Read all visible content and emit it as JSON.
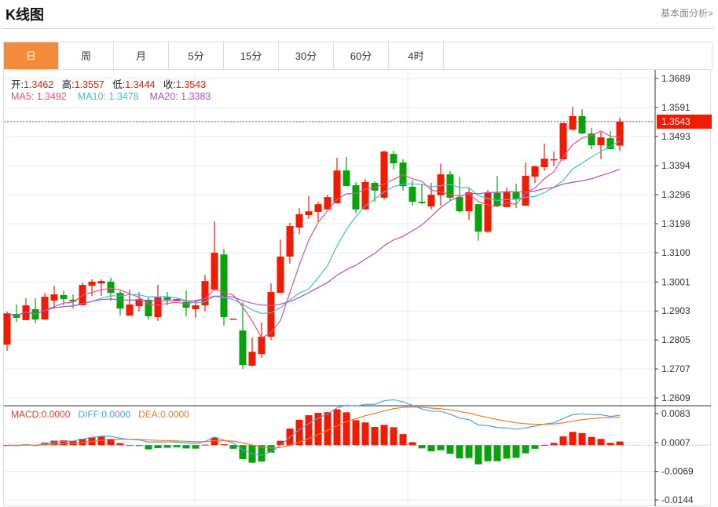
{
  "header": {
    "title": "K线图",
    "fundamental_link": "基本面分析>"
  },
  "tabs": [
    "日",
    "周",
    "月",
    "5分",
    "15分",
    "30分",
    "60分",
    "4时"
  ],
  "active_tab": 0,
  "ohlc_info": {
    "open_label": "开:",
    "open": "1.3462",
    "high_label": "高:",
    "high": "1.3557",
    "low_label": "低:",
    "low": "1.3444",
    "close_label": "收:",
    "close": "1.3543"
  },
  "ma_info": {
    "ma5_label": "MA5: ",
    "ma5": "1.3492",
    "ma10_label": "MA10: ",
    "ma10": "1.3478",
    "ma20_label": "MA20: ",
    "ma20": "1.3383"
  },
  "macd_info": {
    "macd": "MACD:0.0000",
    "diff": "DIFF:0.0000",
    "dea": "DEA:0.0000"
  },
  "current_price": "1.3543",
  "colors": {
    "up": "#f21a00",
    "down": "#0aa20a",
    "ma5": "#e8508a",
    "ma10": "#3fbfd8",
    "ma20": "#b150c8",
    "diff": "#4aa3e8",
    "dea": "#f57a20",
    "active_tab": "#f28c3c"
  },
  "chart_data": {
    "type": "candlestick",
    "price_ticks": [
      "1.3689",
      "1.3591",
      "1.3493",
      "1.3394",
      "1.3296",
      "1.3198",
      "1.3100",
      "1.3001",
      "1.2903",
      "1.2805",
      "1.2707",
      "1.2609"
    ],
    "price_range": [
      1.2609,
      1.3689
    ],
    "macd_ticks": [
      "0.0083",
      "0.0007",
      "-0.0069",
      "-0.0144"
    ],
    "macd_range": [
      -0.0144,
      0.0083
    ],
    "ohlc": [
      [
        1.2789,
        1.2901,
        1.2768,
        1.2895
      ],
      [
        1.2893,
        1.2925,
        1.2866,
        1.288
      ],
      [
        1.2872,
        1.2946,
        1.2872,
        1.2922
      ],
      [
        1.2909,
        1.2946,
        1.2861,
        1.2874
      ],
      [
        1.2874,
        1.2964,
        1.2874,
        1.2951
      ],
      [
        1.2938,
        1.2988,
        1.2914,
        1.2959
      ],
      [
        1.2957,
        1.2972,
        1.2922,
        1.2943
      ],
      [
        1.2941,
        1.2959,
        1.2911,
        1.2935
      ],
      [
        1.2922,
        1.2999,
        1.2922,
        1.2991
      ],
      [
        1.2988,
        1.301,
        1.2954,
        1.3002
      ],
      [
        1.2996,
        1.301,
        1.2954,
        1.3004
      ],
      [
        1.3002,
        1.3015,
        1.2938,
        1.2964
      ],
      [
        1.2964,
        1.2972,
        1.2887,
        1.2911
      ],
      [
        1.2887,
        1.2975,
        1.2887,
        1.2925
      ],
      [
        1.2919,
        1.2967,
        1.2901,
        1.2943
      ],
      [
        1.2941,
        1.2951,
        1.2874,
        1.2885
      ],
      [
        1.2882,
        1.2991,
        1.2869,
        1.2949
      ],
      [
        1.2949,
        1.2967,
        1.2922,
        1.2941
      ],
      [
        1.2942,
        1.2944,
        1.2942,
        1.2943
      ],
      [
        1.2933,
        1.2972,
        1.2885,
        1.2914
      ],
      [
        1.2909,
        1.2941,
        1.288,
        1.2922
      ],
      [
        1.2922,
        1.3025,
        1.2901,
        1.3004
      ],
      [
        1.2975,
        1.3206,
        1.2972,
        1.31
      ],
      [
        1.3094,
        1.3113,
        1.2853,
        1.2882
      ],
      [
        1.2877,
        1.2878,
        1.2876,
        1.2877
      ],
      [
        1.2837,
        1.2933,
        1.2707,
        1.272
      ],
      [
        1.2718,
        1.2813,
        1.2715,
        1.2765
      ],
      [
        1.2757,
        1.2864,
        1.2744,
        1.2816
      ],
      [
        1.2816,
        1.2996,
        1.2805,
        1.2967
      ],
      [
        1.2964,
        1.3145,
        1.2964,
        1.3087
      ],
      [
        1.3087,
        1.3201,
        1.3063,
        1.319
      ],
      [
        1.3185,
        1.3251,
        1.3163,
        1.323
      ],
      [
        1.3227,
        1.3291,
        1.3214,
        1.324
      ],
      [
        1.3238,
        1.3272,
        1.3206,
        1.3264
      ],
      [
        1.3246,
        1.3296,
        1.3246,
        1.3288
      ],
      [
        1.3267,
        1.3421,
        1.3267,
        1.3378
      ],
      [
        1.3378,
        1.3424,
        1.3325,
        1.3325
      ],
      [
        1.3328,
        1.3339,
        1.3233,
        1.3246
      ],
      [
        1.3246,
        1.3349,
        1.3246,
        1.3339
      ],
      [
        1.3336,
        1.3341,
        1.3272,
        1.331
      ],
      [
        1.3286,
        1.3445,
        1.328,
        1.3442
      ],
      [
        1.3434,
        1.3445,
        1.3381,
        1.3402
      ],
      [
        1.3405,
        1.3416,
        1.331,
        1.3325
      ],
      [
        1.3323,
        1.3344,
        1.3259,
        1.3272
      ],
      [
        1.3272,
        1.3333,
        1.3264,
        1.3267
      ],
      [
        1.3256,
        1.3336,
        1.3246,
        1.3296
      ],
      [
        1.3294,
        1.3402,
        1.3259,
        1.3365
      ],
      [
        1.3365,
        1.3376,
        1.3278,
        1.3286
      ],
      [
        1.3288,
        1.3357,
        1.3235,
        1.324
      ],
      [
        1.324,
        1.3317,
        1.3211,
        1.3304
      ],
      [
        1.3264,
        1.3264,
        1.314,
        1.3171
      ],
      [
        1.3171,
        1.3312,
        1.3166,
        1.3304
      ],
      [
        1.3302,
        1.336,
        1.3254,
        1.3259
      ],
      [
        1.3254,
        1.332,
        1.3254,
        1.3304
      ],
      [
        1.3304,
        1.3333,
        1.3251,
        1.328
      ],
      [
        1.3259,
        1.3405,
        1.3259,
        1.336
      ],
      [
        1.3357,
        1.3394,
        1.3336,
        1.3392
      ],
      [
        1.3389,
        1.3469,
        1.3376,
        1.3418
      ],
      [
        1.3413,
        1.3442,
        1.3392,
        1.3416
      ],
      [
        1.3416,
        1.354,
        1.341,
        1.3538
      ],
      [
        1.3516,
        1.3593,
        1.3513,
        1.3562
      ],
      [
        1.3562,
        1.3585,
        1.3501,
        1.3503
      ],
      [
        1.3503,
        1.3522,
        1.345,
        1.3463
      ],
      [
        1.3463,
        1.3508,
        1.3416,
        1.349
      ],
      [
        1.3487,
        1.3511,
        1.3448,
        1.345
      ],
      [
        1.3462,
        1.3557,
        1.3444,
        1.3543
      ]
    ]
  }
}
